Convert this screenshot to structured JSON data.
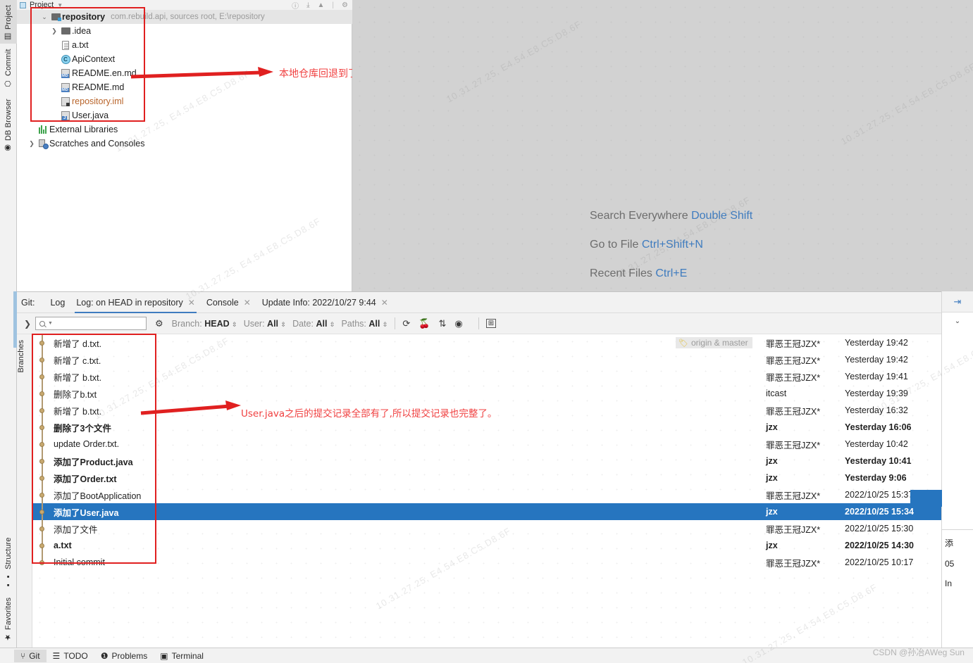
{
  "left_strip": {
    "tabs": [
      {
        "label": "Project",
        "icon": "project-icon",
        "selected": true
      },
      {
        "label": "Commit",
        "icon": "commit-icon",
        "selected": false
      },
      {
        "label": "DB Browser",
        "icon": "database-icon",
        "selected": false
      }
    ],
    "bottom_tabs": [
      {
        "label": "Structure",
        "icon": "structure-icon"
      },
      {
        "label": "Favorites",
        "icon": "star-icon"
      }
    ]
  },
  "project_panel": {
    "title": "Project",
    "title_icon": "project-icon",
    "header_icons": [
      "info-icon",
      "collapse-all-icon",
      "hide-icon",
      "settings-icon"
    ],
    "tree": [
      {
        "twist": "v",
        "icon": "folder-module-icon",
        "label": "repository",
        "bold": true,
        "sub": "com.rebuild.api,  sources root,  E:\\repository",
        "selected": true,
        "indent": 0
      },
      {
        "twist": ">",
        "icon": "folder-icon",
        "label": ".idea",
        "bold": false,
        "sub": "",
        "selected": false,
        "indent": 1
      },
      {
        "twist": "",
        "icon": "file-icon",
        "label": "a.txt",
        "bold": false,
        "sub": "",
        "selected": false,
        "indent": 1
      },
      {
        "twist": "",
        "icon": "class-icon",
        "label": "ApiContext",
        "bold": false,
        "sub": "",
        "selected": false,
        "indent": 1
      },
      {
        "twist": "",
        "icon": "markdown-icon",
        "label": "README.en.md",
        "bold": false,
        "sub": "",
        "selected": false,
        "indent": 1
      },
      {
        "twist": "",
        "icon": "markdown-icon",
        "label": "README.md",
        "bold": false,
        "sub": "",
        "selected": false,
        "indent": 1
      },
      {
        "twist": "",
        "icon": "iml-icon",
        "label": "repository.iml",
        "bold": false,
        "sub": "",
        "selected": false,
        "indent": 1,
        "color": "#b8642a"
      },
      {
        "twist": "",
        "icon": "java-file-icon",
        "label": "User.java",
        "bold": false,
        "sub": "",
        "selected": false,
        "indent": 1
      },
      {
        "twist": "",
        "icon": "external-libraries-icon",
        "label": "External Libraries",
        "bold": false,
        "sub": "",
        "selected": false,
        "indent": 0
      },
      {
        "twist": ">",
        "icon": "scratches-icon",
        "label": "Scratches and Consoles",
        "bold": false,
        "sub": "",
        "selected": false,
        "indent": 0
      }
    ]
  },
  "editor": {
    "shortcuts": [
      {
        "label": "Search Everywhere",
        "key": "Double Shift"
      },
      {
        "label": "Go to File",
        "key": "Ctrl+Shift+N"
      },
      {
        "label": "Recent Files",
        "key": "Ctrl+E"
      }
    ]
  },
  "annotations": [
    {
      "text": "本地仓库回退到了User.java的版本",
      "color": "#f04040"
    },
    {
      "text": "User.java之后的提交记录全部有了,所以提交记录也完整了。",
      "color": "#f04040"
    }
  ],
  "git_panel": {
    "group_label": "Git:",
    "tabs": [
      {
        "label": "Log",
        "active": false,
        "closable": false
      },
      {
        "label": "Log: on HEAD in repository",
        "active": true,
        "closable": true
      },
      {
        "label": "Console",
        "active": false,
        "closable": true
      },
      {
        "label": "Update Info: 2022/10/27 9:44",
        "active": false,
        "closable": true
      }
    ],
    "vertical_tab": "Branches",
    "toolbar": {
      "expand_icon": "chevron-right-icon",
      "search_placeholder": "",
      "search_value": "",
      "search_icon": "search-icon",
      "gear_icon": "gear-icon",
      "filters": [
        {
          "name": "Branch:",
          "value": "HEAD"
        },
        {
          "name": "User:",
          "value": "All"
        },
        {
          "name": "Date:",
          "value": "All"
        },
        {
          "name": "Paths:",
          "value": "All"
        }
      ],
      "icons": [
        "refresh-icon",
        "cherry-pick-icon",
        "sort-icon",
        "show-details-icon",
        "collapse-graph-icon"
      ],
      "right_icons": [
        "search-icon",
        "expand-diff-icon"
      ]
    },
    "columns": {
      "subject": "",
      "author": "",
      "date": ""
    },
    "commits": [
      {
        "subject": "新增了 d.txt.",
        "bold": false,
        "ref": "origin & master",
        "author": "罪恶王冠JZX*",
        "author_bold": false,
        "date": "Yesterday 19:42",
        "date_bold": false,
        "selected": false
      },
      {
        "subject": "新增了 c.txt.",
        "bold": false,
        "ref": "",
        "author": "罪恶王冠JZX*",
        "author_bold": false,
        "date": "Yesterday 19:42",
        "date_bold": false,
        "selected": false
      },
      {
        "subject": "新增了 b.txt.",
        "bold": false,
        "ref": "",
        "author": "罪恶王冠JZX*",
        "author_bold": false,
        "date": "Yesterday 19:41",
        "date_bold": false,
        "selected": false
      },
      {
        "subject": "删除了b.txt",
        "bold": false,
        "ref": "",
        "author": "itcast",
        "author_bold": false,
        "date": "Yesterday 19:39",
        "date_bold": false,
        "selected": false
      },
      {
        "subject": "新增了 b.txt.",
        "bold": false,
        "ref": "",
        "author": "罪恶王冠JZX*",
        "author_bold": false,
        "date": "Yesterday 16:32",
        "date_bold": false,
        "selected": false
      },
      {
        "subject": "删除了3个文件",
        "bold": true,
        "ref": "",
        "author": "jzx",
        "author_bold": true,
        "date": "Yesterday 16:06",
        "date_bold": true,
        "selected": false
      },
      {
        "subject": "update Order.txt.",
        "bold": false,
        "ref": "",
        "author": "罪恶王冠JZX*",
        "author_bold": false,
        "date": "Yesterday 10:42",
        "date_bold": false,
        "selected": false
      },
      {
        "subject": "添加了Product.java",
        "bold": true,
        "ref": "",
        "author": "jzx",
        "author_bold": true,
        "date": "Yesterday 10:41",
        "date_bold": true,
        "selected": false
      },
      {
        "subject": "添加了Order.txt",
        "bold": true,
        "ref": "",
        "author": "jzx",
        "author_bold": true,
        "date": "Yesterday 9:06",
        "date_bold": true,
        "selected": false
      },
      {
        "subject": "添加了BootApplication",
        "bold": false,
        "ref": "",
        "author": "罪恶王冠JZX*",
        "author_bold": false,
        "date": "2022/10/25 15:37",
        "date_bold": false,
        "selected": false
      },
      {
        "subject": "添加了User.java",
        "bold": true,
        "ref": "",
        "author": "jzx",
        "author_bold": true,
        "date": "2022/10/25 15:34",
        "date_bold": true,
        "selected": true
      },
      {
        "subject": "添加了文件",
        "bold": false,
        "ref": "",
        "author": "罪恶王冠JZX*",
        "author_bold": false,
        "date": "2022/10/25 15:30",
        "date_bold": false,
        "selected": false
      },
      {
        "subject": "a.txt",
        "bold": true,
        "ref": "",
        "author": "jzx",
        "author_bold": true,
        "date": "2022/10/25 14:30",
        "date_bold": true,
        "selected": false
      },
      {
        "subject": "Initial commit",
        "bold": false,
        "ref": "",
        "author": "罪恶王冠JZX*",
        "author_bold": false,
        "date": "2022/10/25 10:17",
        "date_bold": false,
        "selected": false
      }
    ]
  },
  "right_rail": {
    "top_icon": "expand-details-icon",
    "chevron_icon": "chevron-down-icon",
    "detail_lines": [
      "添",
      "05",
      "In"
    ]
  },
  "status_bar": {
    "items": [
      {
        "label": "Git",
        "icon": "git-branch-icon",
        "selected": true
      },
      {
        "label": "TODO",
        "icon": "todo-list-icon",
        "selected": false
      },
      {
        "label": "Problems",
        "icon": "problems-icon",
        "selected": false
      },
      {
        "label": "Terminal",
        "icon": "terminal-icon",
        "selected": false
      }
    ]
  },
  "watermarks": {
    "tile_text": "10.31.27.25, E4.54.E8.C5.D8.6F",
    "csdn": "CSDN @孙冶AWeg Sun"
  },
  "colors": {
    "selection_blue": "#2675bf",
    "annotation_red": "#f04040",
    "redbox": "#e02020",
    "accent_link": "#3f7cbf",
    "editor_bg": "#d2d2d2"
  }
}
